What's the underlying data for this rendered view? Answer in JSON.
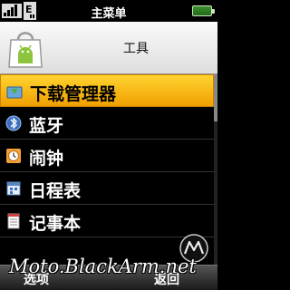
{
  "status_bar": {
    "title": "主菜单",
    "signal_icon": "signal-bars-icon",
    "edge_icon": "edge-network-icon",
    "battery_icon": "battery-icon"
  },
  "header": {
    "icon": "market-bag-icon",
    "title": "工具"
  },
  "menu": {
    "items": [
      {
        "label": "下载管理器",
        "icon": "download-manager-icon",
        "selected": true
      },
      {
        "label": "蓝牙",
        "icon": "bluetooth-icon",
        "selected": false
      },
      {
        "label": "闹钟",
        "icon": "alarm-clock-icon",
        "selected": false
      },
      {
        "label": "日程表",
        "icon": "calendar-icon",
        "selected": false
      },
      {
        "label": "记事本",
        "icon": "notepad-icon",
        "selected": false
      }
    ]
  },
  "softkeys": {
    "left": "选项",
    "right": "返回"
  },
  "watermark": "Moto.BlackArm.net",
  "colors": {
    "selection": "#f5b800",
    "header_bg": "#f0f0f0",
    "battery": "#2e7d24"
  }
}
